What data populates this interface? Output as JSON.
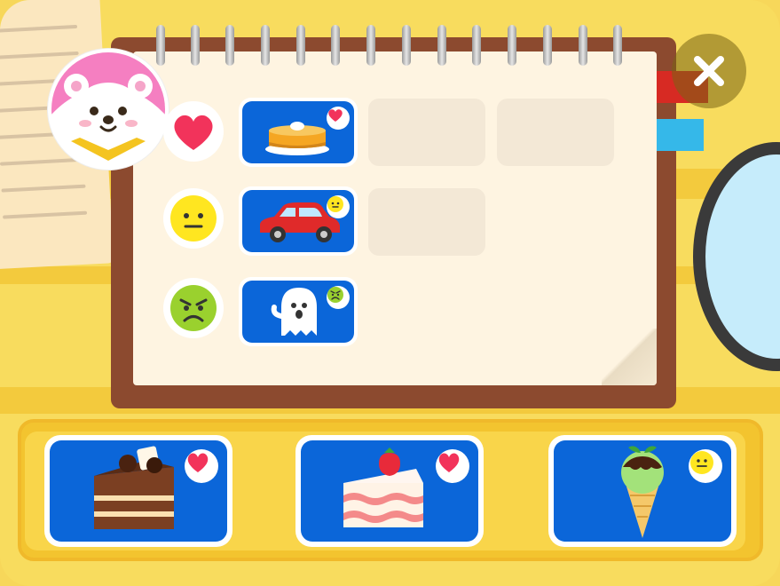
{
  "game": {
    "character": "bear-avatar",
    "close_icon": "close-icon",
    "colors": {
      "card_blue": "#0b66d9",
      "heart_red": "#f2335b",
      "neutral_yellow": "#ffe620",
      "angry_green": "#9ad12e",
      "notebook_brown": "#8c4a2f",
      "page_cream": "#fef4e1",
      "background_yellow": "#f8dc5e"
    },
    "notebook_rows": [
      {
        "category": "love",
        "category_icon": "heart-icon",
        "items": [
          {
            "item": "pudding",
            "reaction": "heart-icon"
          }
        ],
        "empty_slots": 2
      },
      {
        "category": "neutral",
        "category_icon": "neutral-face-icon",
        "items": [
          {
            "item": "car",
            "reaction": "neutral-face-icon"
          }
        ],
        "empty_slots": 1
      },
      {
        "category": "dislike",
        "category_icon": "angry-face-icon",
        "items": [
          {
            "item": "ghost",
            "reaction": "angry-face-icon"
          }
        ],
        "empty_slots": 0
      }
    ],
    "choices": [
      {
        "item": "chocolate-cake",
        "reaction": "heart-icon"
      },
      {
        "item": "strawberry-shortcake",
        "reaction": "heart-icon"
      },
      {
        "item": "mint-ice-cream-cone",
        "reaction": "neutral-face-icon"
      }
    ]
  }
}
